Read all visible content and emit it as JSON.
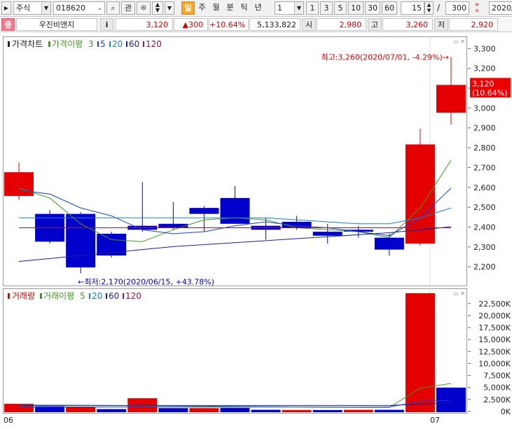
{
  "toolbar": {
    "market_label": "주식",
    "code_value": "018620",
    "search_icon": "search-icon",
    "bookmark_label": "관",
    "periods": [
      "일",
      "주",
      "월",
      "분",
      "틱",
      "년"
    ],
    "active_period": "일",
    "interval_value": "1",
    "interval_buttons": [
      "1",
      "3",
      "5",
      "10",
      "30",
      "60"
    ],
    "count_value": "15",
    "count_sep": "/",
    "total_value": "300",
    "date_value": "2020/"
  },
  "quote": {
    "badge": "증",
    "name": "우진비앤지",
    "info_label": "i",
    "price": "3,120",
    "change": "▲300",
    "change_pct": "+10.64%",
    "volume": "5,133,822",
    "open_label": "시",
    "open": "2,980",
    "high_label": "고",
    "high": "3,260",
    "low_label": "저",
    "low": "2,920"
  },
  "colors": {
    "up": "#e50000",
    "down": "#0000cc",
    "ma3": "#3f9a1f",
    "ma5": "#1a3fd8",
    "ma20": "#1a7fd0",
    "ma60": "#1e1e9c",
    "ma120": "#a3133f"
  },
  "legend_price": {
    "title": "가격차트",
    "ma_label": "가격이평",
    "ma_values": [
      "3",
      "5",
      "20",
      "60",
      "120"
    ]
  },
  "legend_volume": {
    "title": "거래량",
    "ma_label": "거래이평",
    "ma_values": [
      "5",
      "20",
      "60",
      "120"
    ]
  },
  "annotations": {
    "max": "최고:3,260(2020/07/01, -4.29%)→",
    "min": "←최저:2,170(2020/06/15, +43.78%)",
    "current_price": "3,120",
    "current_pct": "(10.64%)"
  },
  "x_labels": [
    "06",
    "07"
  ],
  "chart_data": [
    {
      "type": "candlestick",
      "ylim": [
        2130,
        3340
      ],
      "yticks": [
        "2,200",
        "2,300",
        "2,400",
        "2,500",
        "2,600",
        "2,700",
        "2,800",
        "2,900",
        "3,000",
        "3,100",
        "3,200",
        "3,300"
      ],
      "ytick_values": [
        2200,
        2300,
        2400,
        2500,
        2600,
        2700,
        2800,
        2900,
        3000,
        3100,
        3200,
        3300
      ],
      "candles": [
        {
          "o": 2560,
          "h": 2730,
          "l": 2540,
          "c": 2680
        },
        {
          "o": 2470,
          "h": 2490,
          "l": 2320,
          "c": 2330
        },
        {
          "o": 2470,
          "h": 2480,
          "l": 2170,
          "c": 2200
        },
        {
          "o": 2370,
          "h": 2380,
          "l": 2250,
          "c": 2260
        },
        {
          "o": 2410,
          "h": 2630,
          "l": 2380,
          "c": 2390
        },
        {
          "o": 2420,
          "h": 2530,
          "l": 2390,
          "c": 2400
        },
        {
          "o": 2500,
          "h": 2510,
          "l": 2380,
          "c": 2470
        },
        {
          "o": 2550,
          "h": 2610,
          "l": 2420,
          "c": 2420
        },
        {
          "o": 2410,
          "h": 2450,
          "l": 2340,
          "c": 2390
        },
        {
          "o": 2430,
          "h": 2460,
          "l": 2390,
          "c": 2400
        },
        {
          "o": 2380,
          "h": 2420,
          "l": 2320,
          "c": 2360
        },
        {
          "o": 2390,
          "h": 2410,
          "l": 2350,
          "c": 2380
        },
        {
          "o": 2350,
          "h": 2370,
          "l": 2260,
          "c": 2290
        },
        {
          "o": 2320,
          "h": 2900,
          "l": 2310,
          "c": 2820
        },
        {
          "o": 2980,
          "h": 3260,
          "l": 2920,
          "c": 3120
        }
      ],
      "ma": [
        {
          "key": "ma3",
          "values": [
            2600,
            2550,
            2420,
            2340,
            2330,
            2390,
            2440,
            2450,
            2440,
            2400,
            2390,
            2380,
            2350,
            2500,
            2740
          ]
        },
        {
          "key": "ma5",
          "values": [
            2590,
            2570,
            2500,
            2460,
            2390,
            2370,
            2380,
            2410,
            2430,
            2410,
            2400,
            2380,
            2360,
            2450,
            2600
          ]
        },
        {
          "key": "ma20",
          "values": [
            2450,
            2450,
            2450,
            2450,
            2450,
            2450,
            2450,
            2450,
            2450,
            2440,
            2430,
            2420,
            2420,
            2450,
            2500
          ]
        },
        {
          "key": "ma60",
          "values": [
            2230,
            2245,
            2260,
            2275,
            2290,
            2305,
            2315,
            2325,
            2335,
            2345,
            2355,
            2365,
            2375,
            2390,
            2405
          ]
        },
        {
          "key": "ma120",
          "values": [
            2400,
            2400,
            2400,
            2400,
            2400,
            2400,
            2400,
            2400,
            2400,
            2400,
            2400,
            2400,
            2400,
            2400,
            2400
          ]
        }
      ]
    },
    {
      "type": "bar",
      "ylim": [
        0,
        24800
      ],
      "yticks": [
        "0K",
        "2,500K",
        "5,000K",
        "7,500K",
        "10,000K",
        "12,500K",
        "15,000K",
        "17,500K",
        "20,000K",
        "22,500K"
      ],
      "ytick_values": [
        0,
        2500,
        5000,
        7500,
        10000,
        12500,
        15000,
        17500,
        20000,
        22500
      ],
      "values": [
        1750,
        1250,
        1100,
        650,
        2900,
        850,
        850,
        900,
        500,
        450,
        450,
        500,
        500,
        24900,
        5130
      ],
      "up": [
        true,
        false,
        true,
        false,
        true,
        false,
        true,
        false,
        false,
        true,
        false,
        true,
        false,
        true,
        false
      ],
      "ma": [
        {
          "key": "ma3",
          "values": [
            1500,
            1480,
            1450,
            1400,
            1350,
            1300,
            1250,
            1200,
            1150,
            1100,
            1050,
            1000,
            1000,
            5000,
            6000
          ]
        },
        {
          "key": "ma5",
          "values": [
            1100,
            1100,
            1100,
            1100,
            1100,
            1100,
            1100,
            1100,
            1100,
            1100,
            1050,
            1050,
            1100,
            2200,
            2500
          ]
        },
        {
          "key": "ma60",
          "values": [
            1400,
            1400,
            1400,
            1400,
            1400,
            1400,
            1400,
            1400,
            1400,
            1400,
            1400,
            1400,
            1400,
            1700,
            1900
          ]
        }
      ]
    }
  ]
}
